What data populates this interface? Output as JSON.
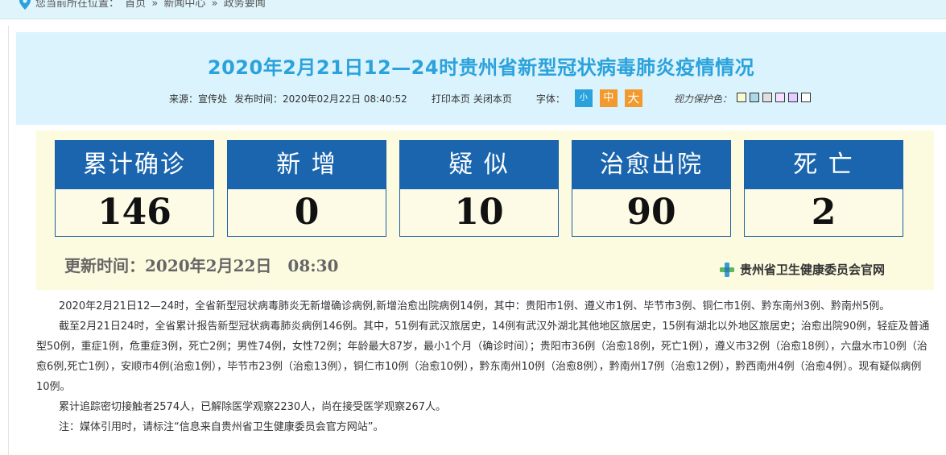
{
  "breadcrumb": {
    "prefix": "您当前所在位置：",
    "items": [
      "首页",
      "»",
      "新闻中心",
      "»",
      "政务要闻"
    ]
  },
  "article_header": {
    "title": "2020年2月21日12—24时贵州省新型冠状病毒肺炎疫情情况",
    "source": "来源：宣传处",
    "publish_time": "发布时间：2020年02月22日 08:40:52",
    "print_link": "打印本页",
    "close_link": "关闭本页",
    "font_label": "字体：",
    "font_small": "小",
    "font_medium": "中",
    "font_large": "大",
    "vision_label": "视力保护色：",
    "vision_colors": [
      "#fafad2",
      "#add8e6",
      "#e0e0e0",
      "#f5e1ff",
      "#e6ccff",
      "#ffffff"
    ]
  },
  "stats": [
    {
      "label": "累计确诊",
      "value": "146"
    },
    {
      "label": "新 增",
      "value": "0"
    },
    {
      "label": "疑 似",
      "value": "10"
    },
    {
      "label": "治愈出院",
      "value": "90"
    },
    {
      "label": "死 亡",
      "value": "2"
    }
  ],
  "update_time": "更新时间：2020年2月22日　08:30",
  "official_site": "贵州省卫生健康委员会官网",
  "paragraphs": [
    "2020年2月21日12—24时，全省新型冠状病毒肺炎无新增确诊病例,新增治愈出院病例14例，其中：贵阳市1例、遵义市1例、毕节市3例、铜仁市1例、黔东南州3例、黔南州5例。",
    "截至2月21日24时，全省累计报告新型冠状病毒肺炎病例146例。其中，51例有武汉旅居史，14例有武汉外湖北其他地区旅居史，15例有湖北以外地区旅居史；治愈出院90例，轻症及普通型50例，重症1例，危重症3例，死亡2例；男性74例，女性72例；年龄最大87岁，最小1个月（确诊时间）；贵阳市36例（治愈18例，死亡1例），遵义市32例（治愈18例），六盘水市10例（治愈6例,死亡1例），安顺市4例(治愈1例），毕节市23例（治愈13例），铜仁市10例（治愈10例），黔东南州10例（治愈8例），黔南州17例（治愈12例），黔西南州4例（治愈4例）。现有疑似病例10例。",
    "累计追踪密切接触者2574人，已解除医学观察2230人，尚在接受医学观察267人。",
    "注：媒体引用时，请标注“信息来自贵州省卫生健康委员会官方网站”。"
  ]
}
